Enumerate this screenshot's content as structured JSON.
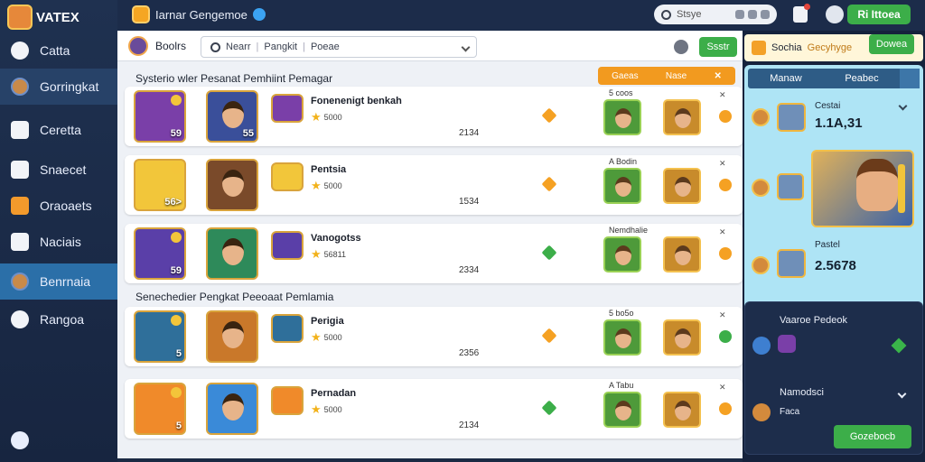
{
  "sidebar": {
    "logo": "VATEX",
    "items": [
      {
        "label": "Catta",
        "icon": "search-icon"
      },
      {
        "label": "Gorringkat",
        "icon": "avatar-icon"
      },
      {
        "label": "Ceretta",
        "icon": "list-icon"
      },
      {
        "label": "Snaecet",
        "icon": "window-icon"
      },
      {
        "label": "Oraoaets",
        "icon": "book-icon"
      },
      {
        "label": "Naciais",
        "icon": "tools-icon"
      },
      {
        "label": "Benrnaia",
        "icon": "avatar-icon"
      },
      {
        "label": "Rangoa",
        "icon": "chat-icon"
      }
    ]
  },
  "topbar": {
    "title": "Iarnar Gengemoe",
    "search_text": "Stsye",
    "button_label": "Ri Ittoea"
  },
  "main": {
    "header_label": "Boolrs",
    "search_items": [
      "Nearr",
      "Pangkit",
      "Poeae"
    ],
    "header_button": "Ssstr",
    "section1": "Systerio wler Pesanat Pemhiint Pemagar",
    "section2": "Senechedier Pengkat Peeoaat Pemlamia",
    "filter": {
      "left": "Gaeas",
      "right": "Nase"
    },
    "rows": [
      {
        "title": "Fonenenigt benkah",
        "rating": "5000",
        "num": "2134",
        "thumb1": "59",
        "thumb2": "55",
        "mark": "5 coos",
        "right_dot": "orange",
        "diamond": "orange",
        "thumb1_color": "#7a3fa8",
        "thumb2_color": "#3a4f9a"
      },
      {
        "title": "Pentsia",
        "rating": "5000",
        "num": "1534",
        "thumb1": "56>",
        "thumb2": "",
        "mark": "A Bodin",
        "right_dot": "orange",
        "diamond": "orange",
        "thumb1_color": "#f2c63a",
        "thumb2_color": "#7a4a2a"
      },
      {
        "title": "Vanogotss",
        "rating": "56811",
        "num": "2334",
        "thumb1": "59",
        "thumb2": "",
        "mark": "Nemdhalie",
        "right_dot": "orange",
        "diamond": "green",
        "thumb1_color": "#5a3fa8",
        "thumb2_color": "#2e8a5a"
      },
      {
        "title": "Perigia",
        "rating": "5000",
        "num": "2356",
        "thumb1": "5",
        "thumb2": "",
        "mark": "5 bo5o",
        "right_dot": "green",
        "diamond": "orange",
        "thumb1_color": "#2f6f9a",
        "thumb2_color": "#c9782a"
      },
      {
        "title": "Pernadan",
        "rating": "5000",
        "num": "2134",
        "thumb1": "5",
        "thumb2": "",
        "mark": "A Tabu",
        "right_dot": "orange",
        "diamond": "green",
        "thumb1_color": "#f08a2a",
        "thumb2_color": "#3a8ad8"
      }
    ]
  },
  "right": {
    "top_label": "Sochia",
    "top_sub": "Gecyhyge",
    "top_button": "Dowea",
    "tabs": [
      "Manaw",
      "Peabec"
    ],
    "item1_label": "Cestai",
    "item1_value": "1.1A,31",
    "item2_label": "Pastel",
    "item2_value": "2.5678",
    "lower_label1": "Vaaroe Pedeok",
    "lower_label2": "Namodsci",
    "lower_sub": "Faca",
    "lower_button": "Gozebocb"
  }
}
